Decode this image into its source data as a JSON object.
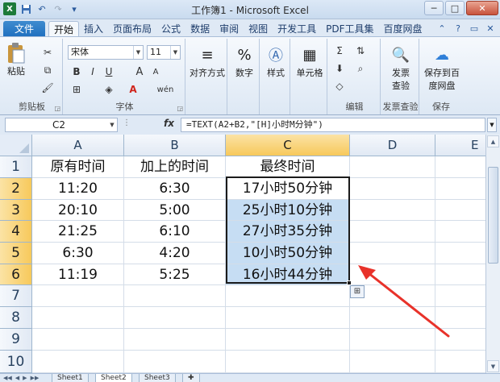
{
  "window": {
    "title": "工作簿1 - Microsoft Excel",
    "buttons": [
      "─",
      "□",
      "✕"
    ]
  },
  "quick_access": [
    "X",
    "💾",
    "↶",
    "↷",
    "▾"
  ],
  "tabs": {
    "file": "文件",
    "items": [
      "开始",
      "插入",
      "页面布局",
      "公式",
      "数据",
      "审阅",
      "视图",
      "开发工具",
      "PDF工具集",
      "百度网盘"
    ],
    "active": "开始"
  },
  "ribbon": {
    "clipboard": {
      "label": "剪贴板",
      "paste": "粘贴"
    },
    "font": {
      "label": "字体",
      "name": "宋体",
      "size": "11",
      "bold": "B",
      "italic": "I",
      "underline": "U",
      "grow": "A",
      "shrink": "A",
      "wen": "wén"
    },
    "alignment": {
      "label": "对齐方式"
    },
    "number": {
      "label": "数字",
      "symbol": "%"
    },
    "styles": {
      "label": "样式"
    },
    "cells": {
      "label": "单元格"
    },
    "editing": {
      "label": "编辑"
    },
    "invoice": {
      "label": "发票查验",
      "button": "发票\n查验"
    },
    "save": {
      "label": "保存",
      "button": "保存到百\n度网盘"
    }
  },
  "formula_bar": {
    "name_box": "C2",
    "fx": "fx",
    "formula": "=TEXT(A2+B2,\"[H]小时M分钟\")"
  },
  "grid": {
    "columns": [
      "A",
      "B",
      "C",
      "D",
      "E"
    ],
    "rows": [
      "1",
      "2",
      "3",
      "4",
      "5",
      "6",
      "7",
      "8",
      "9",
      "10"
    ],
    "header_row": [
      "原有时间",
      "加上的时间",
      "最终时间"
    ],
    "data": [
      [
        "11:20",
        "6:30",
        "17小时50分钟"
      ],
      [
        "20:10",
        "5:00",
        "25小时10分钟"
      ],
      [
        "21:25",
        "6:10",
        "27小时35分钟"
      ],
      [
        "6:30",
        "4:20",
        "10小时50分钟"
      ],
      [
        "11:19",
        "5:25",
        "16小时44分钟"
      ]
    ]
  },
  "sheets": [
    "Sheet1",
    "Sheet2",
    "Sheet3"
  ],
  "active_sheet": "Sheet2",
  "colors": {
    "selection_fill": "#c6ddf3",
    "header_highlight": "#f7c95b",
    "arrow": "#e8322a"
  }
}
